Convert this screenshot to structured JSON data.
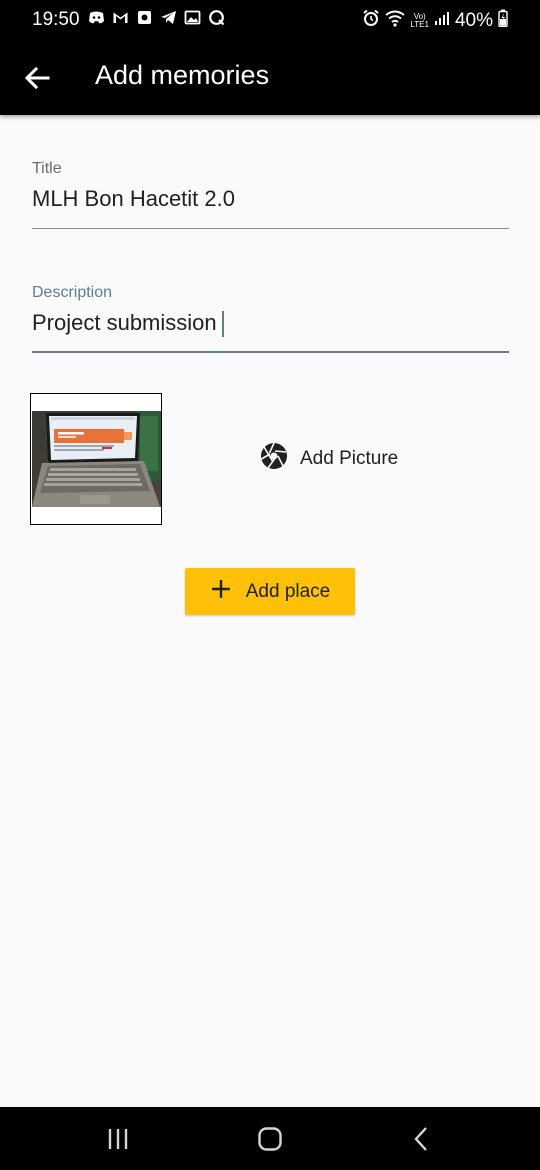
{
  "status_bar": {
    "time": "19:50",
    "battery": "40%",
    "network_label_top": "Vo)",
    "network_label_bottom": "LTE1"
  },
  "app_bar": {
    "title": "Add memories",
    "back_icon": "arrow-left-icon"
  },
  "form": {
    "title_field": {
      "label": "Title",
      "value": "MLH Bon Hacetit 2.0"
    },
    "description_field": {
      "label": "Description",
      "value": "Project submission"
    }
  },
  "add_picture": {
    "label": "Add Picture",
    "icon": "camera-aperture-icon"
  },
  "add_place": {
    "label": "Add place",
    "icon": "plus-icon",
    "color": "#ffc107"
  },
  "colors": {
    "bar_background": "#000000",
    "accent": "#5f7d95",
    "page_background": "#fafafa"
  }
}
